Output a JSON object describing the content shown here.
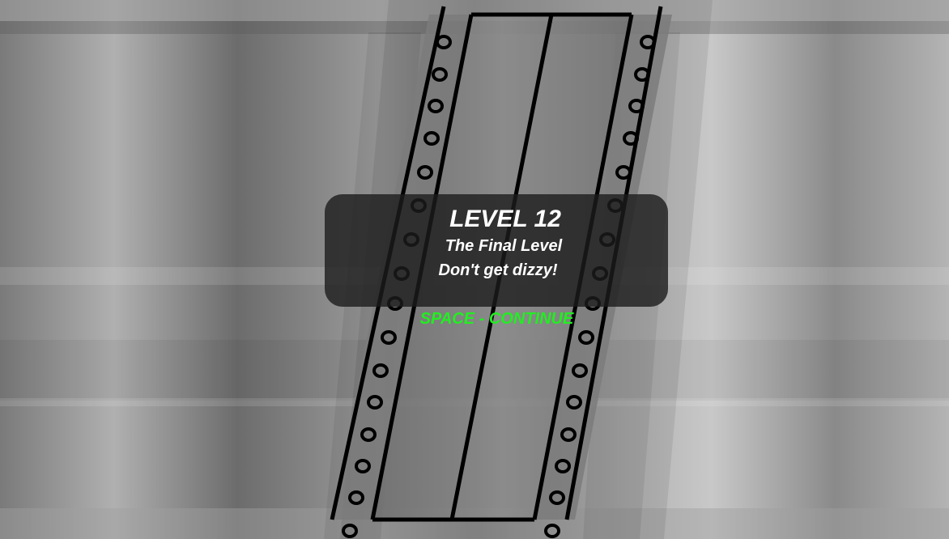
{
  "level_card": {
    "title": "LEVEL 12",
    "subtitle": "The Final Level",
    "hint": "Don't get dizzy!"
  },
  "prompt": {
    "continue_label": "SPACE - CONTINUE",
    "color": "#22ee22"
  },
  "theme": {
    "background": "#8a8a8a",
    "panel": "#1c1c1c",
    "film_strip": "#000000"
  }
}
